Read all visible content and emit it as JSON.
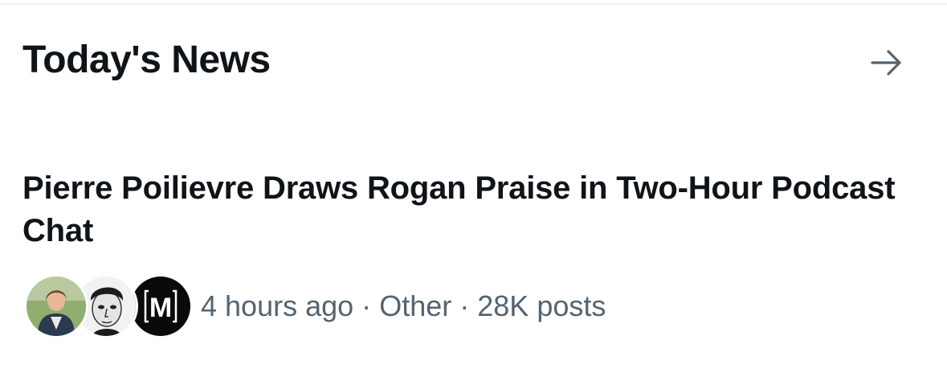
{
  "section": {
    "title": "Today's News",
    "more_icon": "arrow-right-icon"
  },
  "story": {
    "headline": "Pierre Poilievre Draws Rogan Praise in Two-Hour Podcast Chat",
    "time_ago": "4 hours ago",
    "separator": "·",
    "category": "Other",
    "post_count": "28K posts",
    "avatars": [
      {
        "kind": "photo-avatar",
        "description_icon": "person-photo-icon"
      },
      {
        "kind": "sketch-avatar",
        "description_icon": "sketch-portrait-icon"
      },
      {
        "kind": "logo-avatar",
        "description_icon": "m-logo-icon",
        "logo_text": "M"
      }
    ]
  },
  "colors": {
    "text_primary": "#0f1419",
    "text_secondary": "#536471",
    "divider": "#eff3f4",
    "background": "#ffffff"
  }
}
